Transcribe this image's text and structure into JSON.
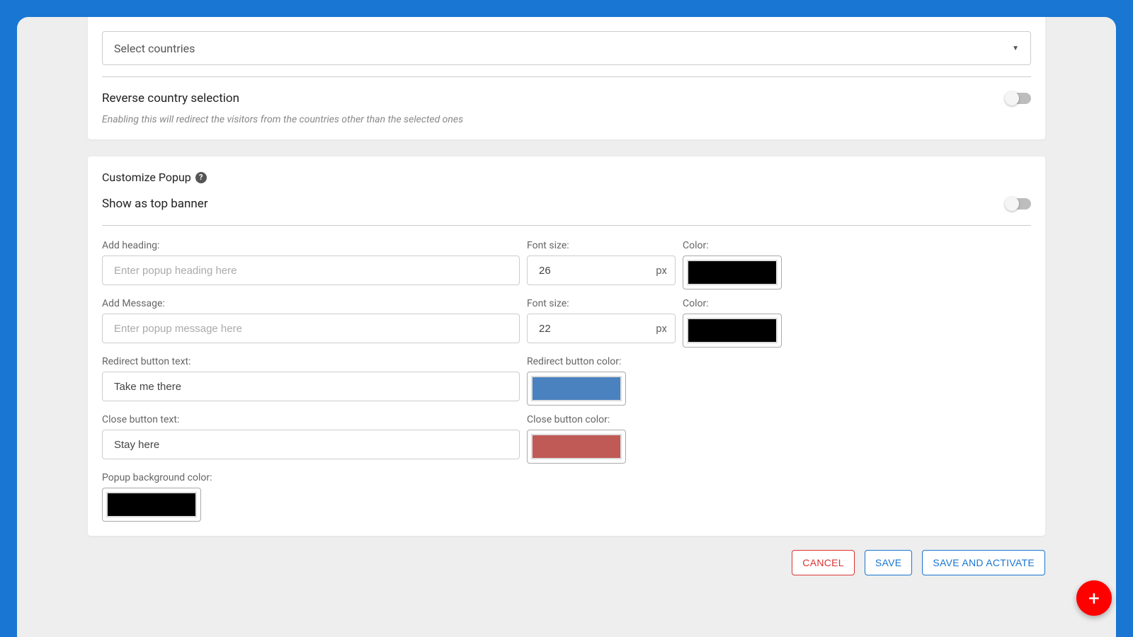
{
  "countrySelect": {
    "placeholder": "Select countries"
  },
  "reverse": {
    "label": "Reverse country selection",
    "help": "Enabling this will redirect the visitors from the countries other than the selected ones"
  },
  "customize": {
    "title": "Customize Popup",
    "topBanner": "Show as top banner"
  },
  "labels": {
    "addHeading": "Add heading:",
    "addMessage": "Add Message:",
    "fontSize": "Font size:",
    "color": "Color:",
    "redirectText": "Redirect button text:",
    "redirectColor": "Redirect button color:",
    "closeText": "Close button text:",
    "closeColor": "Close button color:",
    "popupBg": "Popup background color:",
    "px": "px"
  },
  "placeholders": {
    "heading": "Enter popup heading here",
    "message": "Enter popup message here"
  },
  "values": {
    "headingFontSize": "26",
    "messageFontSize": "22",
    "redirectText": "Take me there",
    "closeText": "Stay here"
  },
  "colors": {
    "heading": "#000000",
    "message": "#000000",
    "redirect": "#4a81bf",
    "close": "#c05a56",
    "popupBg": "#000000"
  },
  "buttons": {
    "cancel": "CANCEL",
    "save": "SAVE",
    "saveActivate": "SAVE AND ACTIVATE"
  }
}
